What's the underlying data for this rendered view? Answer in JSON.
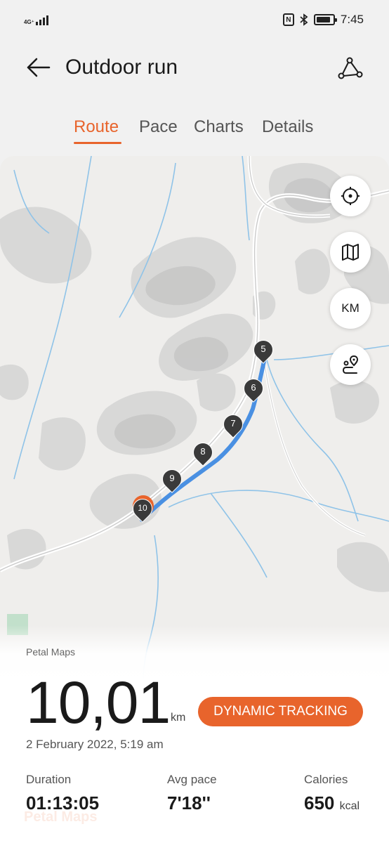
{
  "status_bar": {
    "network": "4G⁺",
    "time": "7:45",
    "battery_level": 0.85,
    "icons": [
      "signal-icon",
      "nfc-icon",
      "bluetooth-icon",
      "battery-icon"
    ]
  },
  "header": {
    "title": "Outdoor run",
    "back_icon": "arrow-left-icon",
    "route_icon": "route-icon"
  },
  "tabs": [
    {
      "label": "Route",
      "active": true
    },
    {
      "label": "Pace",
      "active": false
    },
    {
      "label": "Charts",
      "active": false
    },
    {
      "label": "Details",
      "active": false
    }
  ],
  "map": {
    "controls": [
      {
        "name": "locate-button",
        "icon": "crosshair-icon",
        "label": ""
      },
      {
        "name": "map-layers-button",
        "icon": "map-icon",
        "label": ""
      },
      {
        "name": "km-toggle-button",
        "icon": "",
        "label": "KM"
      },
      {
        "name": "route-replay-button",
        "icon": "route-pin-icon",
        "label": ""
      }
    ],
    "km_markers": [
      "5",
      "6",
      "7",
      "8",
      "9",
      "10"
    ],
    "attribution": "Petal Maps",
    "colors": {
      "route": "#4a90e2",
      "end_marker": "#e8642c",
      "km_marker": "#3a3a3a"
    }
  },
  "summary": {
    "distance": "10,01",
    "distance_unit": "km",
    "tracking_button": "DYNAMIC TRACKING",
    "date": "2 February 2022, 5:19 am",
    "metrics": [
      {
        "label": "Duration",
        "value": "01:13:05",
        "unit": ""
      },
      {
        "label": "Avg pace",
        "value": "7'18''",
        "unit": ""
      },
      {
        "label": "Calories",
        "value": "650",
        "unit": "kcal"
      }
    ],
    "watermark": "Petal Maps"
  },
  "accent_color": "#e8642c"
}
